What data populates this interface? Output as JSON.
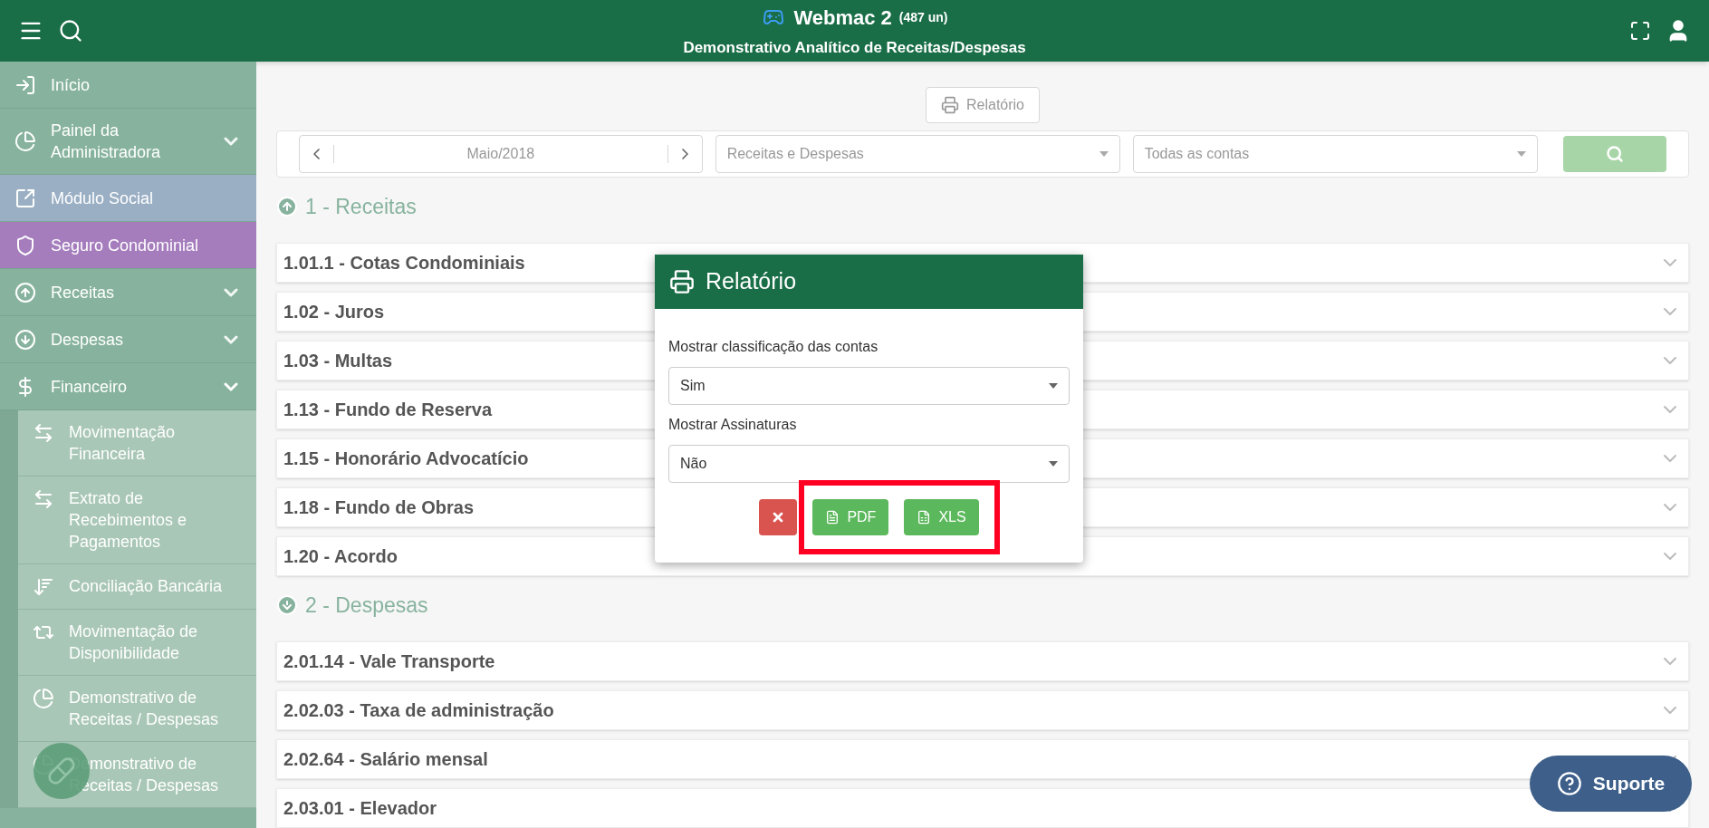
{
  "header": {
    "title": "Webmac 2",
    "units": "(487 un)",
    "subtitle": "Demonstrativo Analítico de Receitas/Despesas"
  },
  "sidebar": {
    "items": [
      {
        "label": "Início",
        "color": "#87b39e"
      },
      {
        "label": "Painel da Administradora",
        "color": "#87b39e",
        "expanded": false
      },
      {
        "label": "Módulo Social",
        "color": "#9aafc4"
      },
      {
        "label": "Seguro Condominial",
        "color": "#a57dbd"
      },
      {
        "label": "Receitas",
        "color": "#87b39e",
        "expanded": false
      },
      {
        "label": "Despesas",
        "color": "#87b39e",
        "expanded": false
      },
      {
        "label": "Financeiro",
        "color": "#87b39e",
        "expanded": true,
        "children": [
          {
            "label": "Movimentação Financeira"
          },
          {
            "label": "Extrato de Recebimentos e Pagamentos"
          },
          {
            "label": "Conciliação Bancária"
          },
          {
            "label": "Movimentação de Disponibilidade"
          },
          {
            "label": "Demonstrativo de Receitas / Despesas"
          },
          {
            "label": "Demonstrativo de Receitas / Despesas"
          }
        ]
      }
    ]
  },
  "report_button": {
    "label": "Relatório"
  },
  "filters": {
    "period": "Maio/2018",
    "type": "Receitas e Despesas",
    "accounts": "Todas as contas"
  },
  "sections": [
    {
      "kind": "up",
      "title": "1 - Receitas",
      "rows": [
        "1.01.1 - Cotas Condominiais",
        "1.02 - Juros",
        "1.03 - Multas",
        "1.13 - Fundo de Reserva",
        "1.15 - Honorário Advocatício",
        "1.18 - Fundo de Obras",
        "1.20 - Acordo"
      ]
    },
    {
      "kind": "down",
      "title": "2 - Despesas",
      "rows": [
        "2.01.14 - Vale Transporte",
        "2.02.03 - Taxa de administração",
        "2.02.64 - Salário mensal",
        "2.03.01 - Elevador"
      ]
    }
  ],
  "modal": {
    "title": "Relatório",
    "fields": [
      {
        "label": "Mostrar classificação das contas",
        "value": "Sim"
      },
      {
        "label": "Mostrar Assinaturas",
        "value": "Não"
      }
    ],
    "buttons": [
      {
        "kind": "close"
      },
      {
        "kind": "pdf",
        "label": "PDF"
      },
      {
        "kind": "xls",
        "label": "XLS"
      }
    ]
  },
  "support": {
    "label": "Suporte"
  }
}
